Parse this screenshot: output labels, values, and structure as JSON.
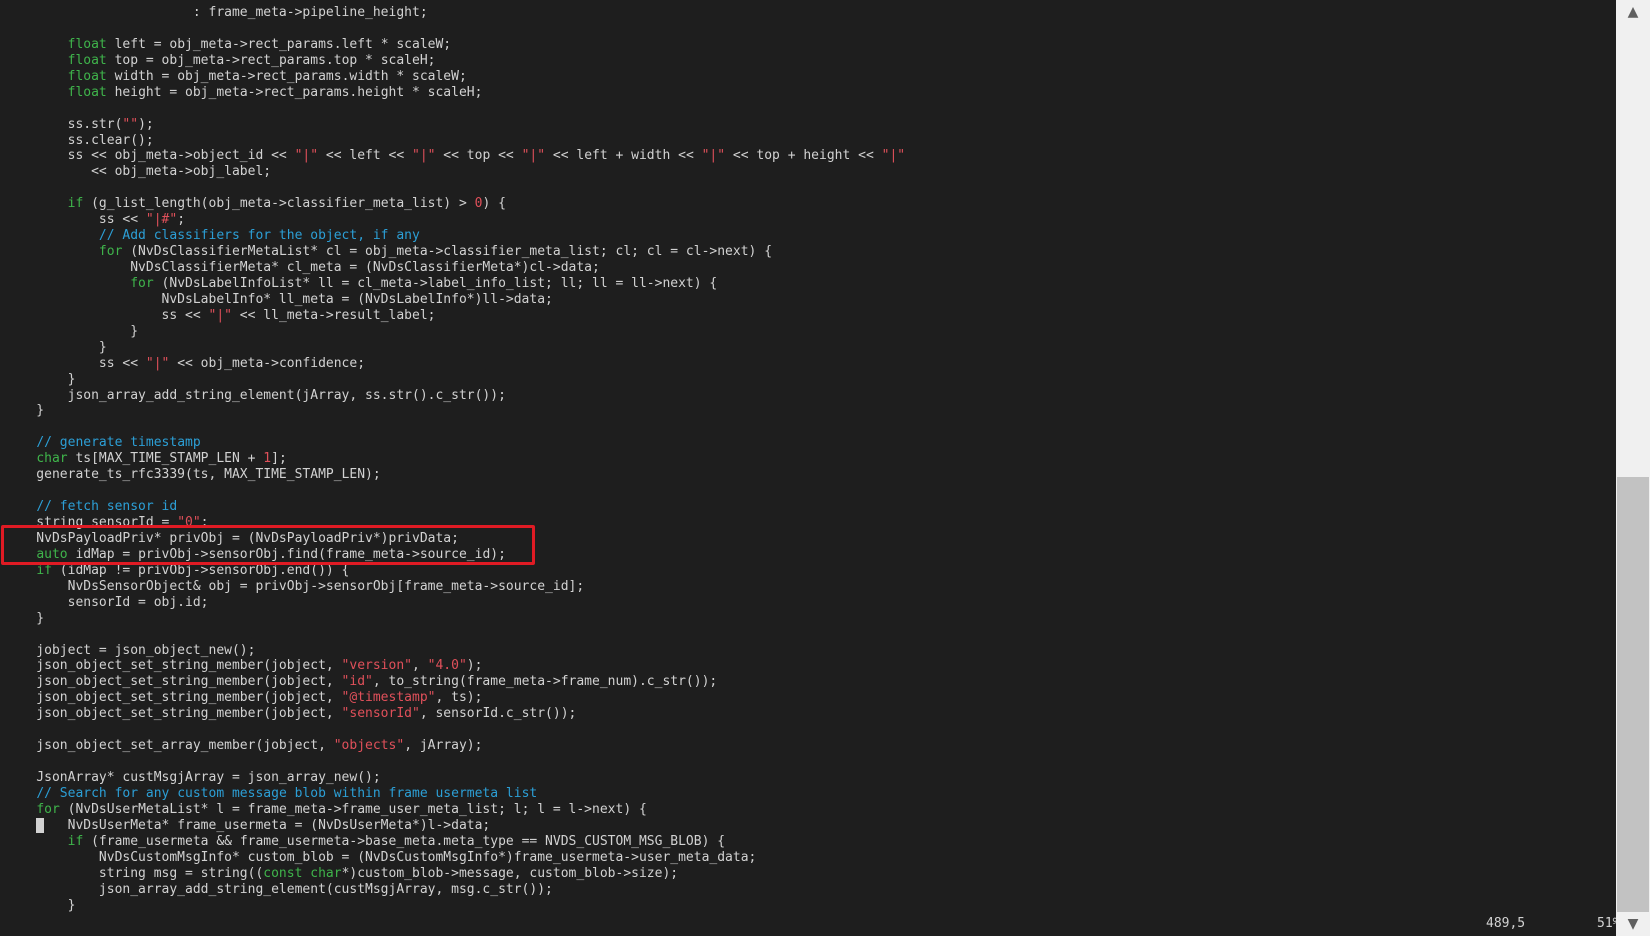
{
  "editor": {
    "lines": [
      [
        {
          "t": "                        : frame_meta->pipeline_height;"
        }
      ],
      [],
      [
        {
          "t": "        "
        },
        {
          "t": "float",
          "c": "kw"
        },
        {
          "t": " left = obj_meta->rect_params.left * scaleW;"
        }
      ],
      [
        {
          "t": "        "
        },
        {
          "t": "float",
          "c": "kw"
        },
        {
          "t": " top = obj_meta->rect_params.top * scaleH;"
        }
      ],
      [
        {
          "t": "        "
        },
        {
          "t": "float",
          "c": "kw"
        },
        {
          "t": " width = obj_meta->rect_params.width * scaleW;"
        }
      ],
      [
        {
          "t": "        "
        },
        {
          "t": "float",
          "c": "kw"
        },
        {
          "t": " height = obj_meta->rect_params.height * scaleH;"
        }
      ],
      [],
      [
        {
          "t": "        ss.str("
        },
        {
          "t": "\"\"",
          "c": "str"
        },
        {
          "t": ");"
        }
      ],
      [
        {
          "t": "        ss.clear();"
        }
      ],
      [
        {
          "t": "        ss << obj_meta->object_id << "
        },
        {
          "t": "\"|\"",
          "c": "str"
        },
        {
          "t": " << left << "
        },
        {
          "t": "\"|\"",
          "c": "str"
        },
        {
          "t": " << top << "
        },
        {
          "t": "\"|\"",
          "c": "str"
        },
        {
          "t": " << left + width << "
        },
        {
          "t": "\"|\"",
          "c": "str"
        },
        {
          "t": " << top + height << "
        },
        {
          "t": "\"|\"",
          "c": "str"
        }
      ],
      [
        {
          "t": "           << obj_meta->obj_label;"
        }
      ],
      [],
      [
        {
          "t": "        "
        },
        {
          "t": "if",
          "c": "kw"
        },
        {
          "t": " (g_list_length(obj_meta->classifier_meta_list) > "
        },
        {
          "t": "0",
          "c": "num"
        },
        {
          "t": ") {"
        }
      ],
      [
        {
          "t": "            ss << "
        },
        {
          "t": "\"|#\"",
          "c": "str"
        },
        {
          "t": ";"
        }
      ],
      [
        {
          "t": "            "
        },
        {
          "t": "// Add classifiers for the object, if any",
          "c": "cm"
        }
      ],
      [
        {
          "t": "            "
        },
        {
          "t": "for",
          "c": "kw"
        },
        {
          "t": " (NvDsClassifierMetaList* cl = obj_meta->classifier_meta_list; cl; cl = cl->next) {"
        }
      ],
      [
        {
          "t": "                NvDsClassifierMeta* cl_meta = (NvDsClassifierMeta*)cl->data;"
        }
      ],
      [
        {
          "t": "                "
        },
        {
          "t": "for",
          "c": "kw"
        },
        {
          "t": " (NvDsLabelInfoList* ll = cl_meta->label_info_list; ll; ll = ll->next) {"
        }
      ],
      [
        {
          "t": "                    NvDsLabelInfo* ll_meta = (NvDsLabelInfo*)ll->data;"
        }
      ],
      [
        {
          "t": "                    ss << "
        },
        {
          "t": "\"|\"",
          "c": "str"
        },
        {
          "t": " << ll_meta->result_label;"
        }
      ],
      [
        {
          "t": "                }"
        }
      ],
      [
        {
          "t": "            }"
        }
      ],
      [
        {
          "t": "            ss << "
        },
        {
          "t": "\"|\"",
          "c": "str"
        },
        {
          "t": " << obj_meta->confidence;"
        }
      ],
      [
        {
          "t": "        }"
        }
      ],
      [
        {
          "t": "        json_array_add_string_element(jArray, ss.str().c_str());"
        }
      ],
      [
        {
          "t": "    }"
        }
      ],
      [],
      [
        {
          "t": "    "
        },
        {
          "t": "// generate timestamp",
          "c": "cm"
        }
      ],
      [
        {
          "t": "    "
        },
        {
          "t": "char",
          "c": "kw"
        },
        {
          "t": " ts[MAX_TIME_STAMP_LEN + "
        },
        {
          "t": "1",
          "c": "num"
        },
        {
          "t": "];"
        }
      ],
      [
        {
          "t": "    generate_ts_rfc3339(ts, MAX_TIME_STAMP_LEN);"
        }
      ],
      [],
      [
        {
          "t": "    "
        },
        {
          "t": "// fetch sensor id",
          "c": "cm"
        }
      ],
      [
        {
          "t": "    string sensorId = "
        },
        {
          "t": "\"0\"",
          "c": "str"
        },
        {
          "t": ";"
        }
      ],
      [
        {
          "t": "    NvDsPayloadPriv* privObj = (NvDsPayloadPriv*)privData;"
        }
      ],
      [
        {
          "t": "    "
        },
        {
          "t": "auto",
          "c": "kw"
        },
        {
          "t": " idMap = privObj->sensorObj.find(frame_meta->source_id);"
        }
      ],
      [
        {
          "t": "    "
        },
        {
          "t": "if",
          "c": "kw"
        },
        {
          "t": " (idMap != privObj->sensorObj.end()) {"
        }
      ],
      [
        {
          "t": "        NvDsSensorObject& obj = privObj->sensorObj[frame_meta->source_id];"
        }
      ],
      [
        {
          "t": "        sensorId = obj.id;"
        }
      ],
      [
        {
          "t": "    }"
        }
      ],
      [],
      [
        {
          "t": "    jobject = json_object_new();"
        }
      ],
      [
        {
          "t": "    json_object_set_string_member(jobject, "
        },
        {
          "t": "\"version\"",
          "c": "str"
        },
        {
          "t": ", "
        },
        {
          "t": "\"4.0\"",
          "c": "str"
        },
        {
          "t": ");"
        }
      ],
      [
        {
          "t": "    json_object_set_string_member(jobject, "
        },
        {
          "t": "\"id\"",
          "c": "str"
        },
        {
          "t": ", to_string(frame_meta->frame_num).c_str());"
        }
      ],
      [
        {
          "t": "    json_object_set_string_member(jobject, "
        },
        {
          "t": "\"@timestamp\"",
          "c": "str"
        },
        {
          "t": ", ts);"
        }
      ],
      [
        {
          "t": "    json_object_set_string_member(jobject, "
        },
        {
          "t": "\"sensorId\"",
          "c": "str"
        },
        {
          "t": ", sensorId.c_str());"
        }
      ],
      [],
      [
        {
          "t": "    json_object_set_array_member(jobject, "
        },
        {
          "t": "\"objects\"",
          "c": "str"
        },
        {
          "t": ", jArray);"
        }
      ],
      [],
      [
        {
          "t": "    JsonArray* custMsgjArray = json_array_new();"
        }
      ],
      [
        {
          "t": "    "
        },
        {
          "t": "// Search for any custom message blob within frame usermeta list",
          "c": "cm"
        }
      ],
      [
        {
          "t": "    "
        },
        {
          "t": "for",
          "c": "kw"
        },
        {
          "t": " (NvDsUserMetaList* l = frame_meta->frame_user_meta_list; l; l = l->next) {"
        }
      ],
      [
        {
          "t": "    "
        },
        {
          "t": " ",
          "c": "cursor"
        },
        {
          "t": "   NvDsUserMeta* frame_usermeta = (NvDsUserMeta*)l->data;"
        }
      ],
      [
        {
          "t": "        "
        },
        {
          "t": "if",
          "c": "kw"
        },
        {
          "t": " (frame_usermeta && frame_usermeta->base_meta.meta_type == NVDS_CUSTOM_MSG_BLOB) {"
        }
      ],
      [
        {
          "t": "            NvDsCustomMsgInfo* custom_blob = (NvDsCustomMsgInfo*)frame_usermeta->user_meta_data;"
        }
      ],
      [
        {
          "t": "            string msg = string(("
        },
        {
          "t": "const char",
          "c": "kw"
        },
        {
          "t": "*)custom_blob->message, custom_blob->size);"
        }
      ],
      [
        {
          "t": "            json_array_add_string_element(custMsgjArray, msg.c_str());"
        }
      ],
      [
        {
          "t": "        }"
        }
      ]
    ]
  },
  "status": {
    "position": "489,5",
    "percent": "51%"
  },
  "scrollbar": {
    "up_icon": "▲",
    "down_icon": "▼",
    "thumb_fraction_start": 0.51,
    "thumb_fraction_size": 0.49
  },
  "colors": {
    "background": "#1e1e1e",
    "text": "#d2d2d2",
    "keyword": "#3fb44b",
    "string": "#e0505a",
    "comment": "#2c9fd6",
    "highlight_box": "#e01b24"
  }
}
